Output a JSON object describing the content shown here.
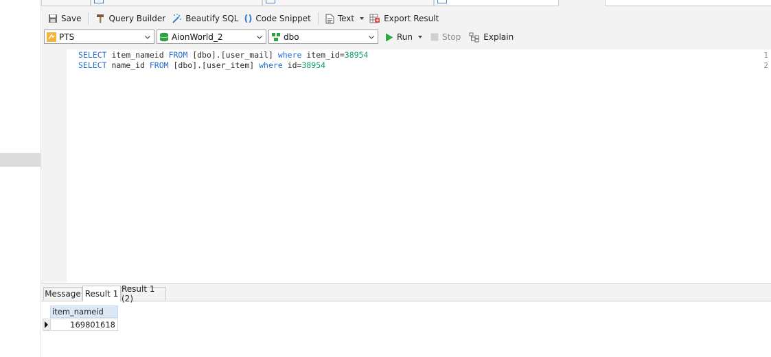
{
  "toolbar": {
    "save": "Save",
    "query_builder": "Query Builder",
    "beautify_sql": "Beautify SQL",
    "code_snippet": "Code Snippet",
    "text": "Text",
    "export_result": "Export Result"
  },
  "selectors": {
    "connection": "PTS",
    "database": "AionWorld_2",
    "schema": "dbo"
  },
  "run_controls": {
    "run": "Run",
    "stop": "Stop",
    "explain": "Explain"
  },
  "editor": {
    "lines": [
      {
        "num": "1",
        "tokens": [
          {
            "t": "SELECT",
            "c": "kw"
          },
          {
            "t": " item_nameid ",
            "c": ""
          },
          {
            "t": "FROM",
            "c": "kw"
          },
          {
            "t": " [dbo].[user_mail] ",
            "c": ""
          },
          {
            "t": "where",
            "c": "kw"
          },
          {
            "t": " item_id=",
            "c": ""
          },
          {
            "t": "38954",
            "c": "num"
          }
        ]
      },
      {
        "num": "2",
        "tokens": [
          {
            "t": "SELECT",
            "c": "kw"
          },
          {
            "t": " name_id ",
            "c": ""
          },
          {
            "t": "FROM",
            "c": "kw"
          },
          {
            "t": " [dbo].[user_item] ",
            "c": ""
          },
          {
            "t": "where",
            "c": "kw"
          },
          {
            "t": " id=",
            "c": ""
          },
          {
            "t": "38954",
            "c": "num"
          }
        ]
      }
    ]
  },
  "result_tabs": {
    "message": "Message",
    "result1": "Result 1",
    "result1_2": "Result 1 (2)"
  },
  "result_grid": {
    "column": "item_nameid",
    "rows": [
      "169801618"
    ]
  },
  "colors": {
    "keyword": "#1f6fd0",
    "number": "#0aa060",
    "run_green": "#2eaa3c"
  }
}
